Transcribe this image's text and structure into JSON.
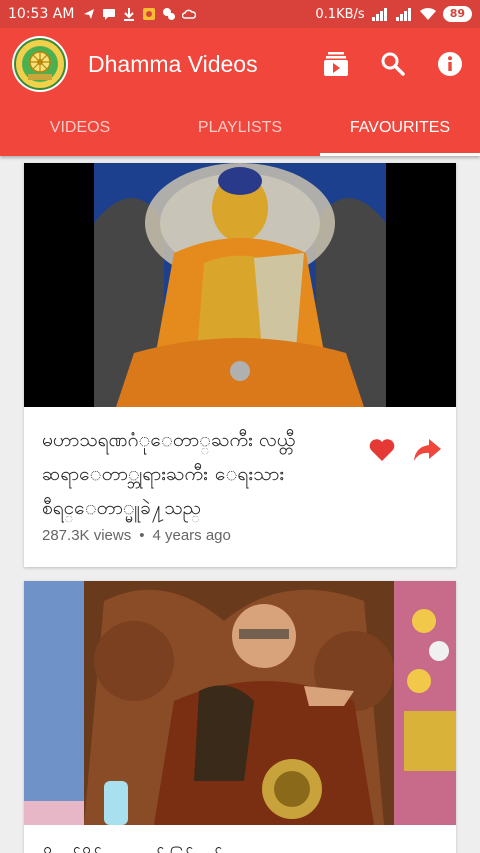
{
  "status_bar": {
    "time": "10:53 AM",
    "net_speed": "0.1KB/s",
    "battery": "89"
  },
  "app_bar": {
    "title": "Dhamma Videos",
    "actions": [
      "playlist-icon",
      "search-icon",
      "info-icon"
    ]
  },
  "tabs": [
    {
      "label": "VIDEOS",
      "active": false
    },
    {
      "label": "PLAYLISTS",
      "active": false
    },
    {
      "label": "FAVOURITES",
      "active": true
    }
  ],
  "videos": [
    {
      "title_lines": [
        "မဟာသရဏဂံုေတာ္ႀကီး  လယ္တီ",
        "ဆရာေတာ္ဘုရားႀကီး ေရးသား",
        "စီရင္ေတာ္မူခဲ႔သည္"
      ],
      "views": "287.3K views",
      "age": "4 years ago"
    },
    {
      "title_lines": [
        "ဓိဌာန်ပိုင်းကမ္မဋ္ဌာန်းပြင်ဆင်"
      ],
      "views": "",
      "age": ""
    }
  ],
  "colors": {
    "primary": "#f0463c",
    "status": "#d8423a",
    "heart": "#e53935"
  }
}
